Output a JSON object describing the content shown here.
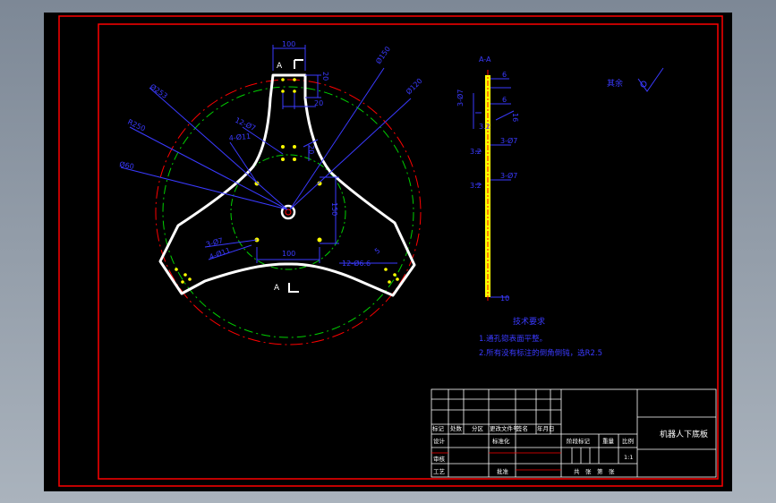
{
  "dims": {
    "top_width": "100",
    "top_height": "20",
    "hole_spacing": "20",
    "dia_large": "Ø253",
    "dia_r": "R250",
    "dia_mid": "Ø150",
    "dia_60": "Ø60",
    "dia_120": "Ø120",
    "holes_a": "12-Ø7",
    "holes_b": "4-Ø11",
    "holes_c": "3-Ø7",
    "holes_d": "4-Ø11",
    "spacing_v": "20",
    "dim_150": "150",
    "bottom_width": "100",
    "holes_e": "12-Ø6.6",
    "small_5": "5"
  },
  "section": {
    "label": "A-A",
    "marker_top": "A",
    "marker_bottom": "A",
    "d1": "6",
    "d2": "6",
    "d3": "3-Ø7",
    "d4": "3-Ø7",
    "d5": "3-Ø7",
    "d6": "16",
    "d7": "3.2",
    "d8": "3.2",
    "d9": "3.2",
    "d10": "10"
  },
  "surface": {
    "remaining_label": "其余"
  },
  "tech": {
    "title": "技术要求",
    "line1": "1.通孔锪表面平整。",
    "line2": "2.所有没有标注的倒角倒钝，选R2.5"
  },
  "title_block": {
    "drawing_name": "机器人下底板",
    "labels": {
      "mark": "标记",
      "count": "处数",
      "zone": "分区",
      "change_doc": "更改文件号",
      "signature": "签名",
      "date": "年月日",
      "design": "设计",
      "standardize": "标准化",
      "check": "审核",
      "process": "工艺",
      "approve": "批准",
      "stage_mark": "阶段标记",
      "weight": "重量",
      "scale": "比例",
      "scale_value": "1:1",
      "sheets": "共　张　第　张"
    }
  },
  "colors": {
    "border": "#ff0000",
    "dimension": "#3a3aff",
    "centerline": "#00d000",
    "outline": "#ffffff",
    "section_fill": "#ffff00",
    "holes": "#ffff00"
  }
}
